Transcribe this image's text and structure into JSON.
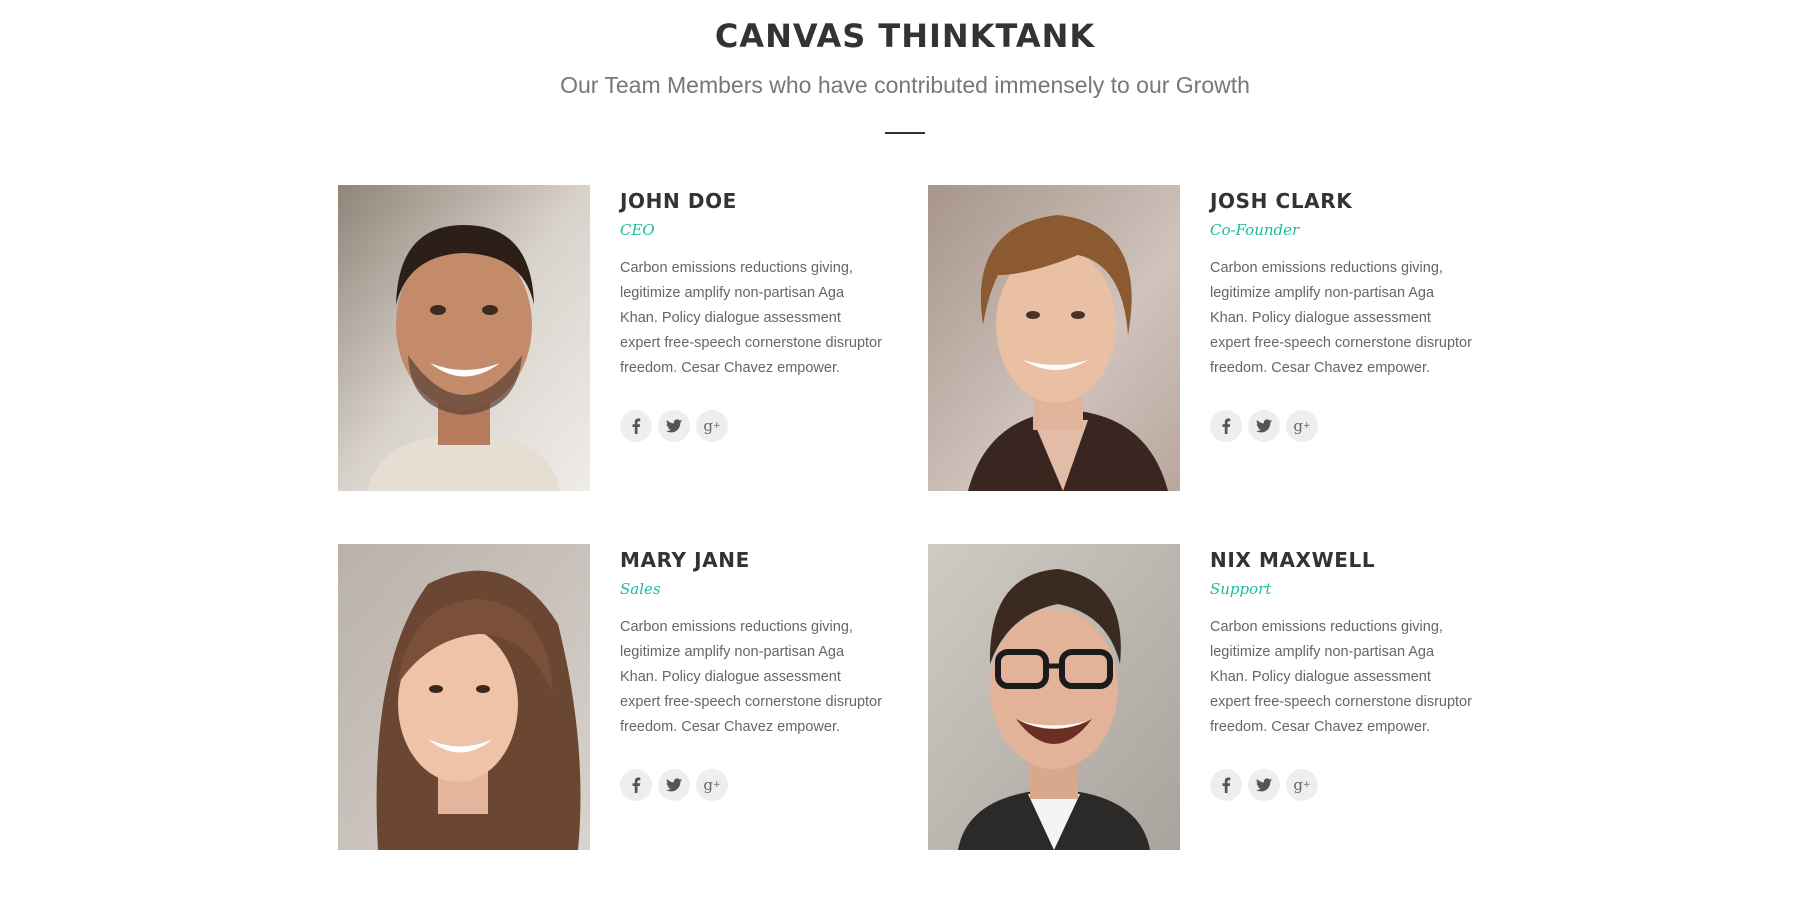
{
  "header": {
    "title": "CANVAS THINKTANK",
    "subtitle": "Our Team Members who have contributed immensely to our Growth"
  },
  "colors": {
    "accent": "#1abc9c",
    "heading": "#333333",
    "body_text": "#666666",
    "social_bg": "#eeeeee"
  },
  "team": [
    {
      "name": "JOHN DOE",
      "role": "CEO",
      "bio": "Carbon emissions reductions giving, legitimize amplify non-partisan Aga Khan. Policy dialogue assessment expert free-speech cornerstone disruptor freedom. Cesar Chavez empower.",
      "photo": "man-smiling-beard-photo",
      "socials": [
        "facebook-icon",
        "twitter-icon",
        "google-plus-icon"
      ]
    },
    {
      "name": "JOSH CLARK",
      "role": "Co-Founder",
      "bio": "Carbon emissions reductions giving, legitimize amplify non-partisan Aga Khan. Policy dialogue assessment expert free-speech cornerstone disruptor freedom. Cesar Chavez empower.",
      "photo": "young-man-wavy-hair-photo",
      "socials": [
        "facebook-icon",
        "twitter-icon",
        "google-plus-icon"
      ]
    },
    {
      "name": "MARY JANE",
      "role": "Sales",
      "bio": "Carbon emissions reductions giving, legitimize amplify non-partisan Aga Khan. Policy dialogue assessment expert free-speech cornerstone disruptor freedom. Cesar Chavez empower.",
      "photo": "woman-long-hair-photo",
      "socials": [
        "facebook-icon",
        "twitter-icon",
        "google-plus-icon"
      ]
    },
    {
      "name": "NIX MAXWELL",
      "role": "Support",
      "bio": "Carbon emissions reductions giving, legitimize amplify non-partisan Aga Khan. Policy dialogue assessment expert free-speech cornerstone disruptor freedom. Cesar Chavez empower.",
      "photo": "man-glasses-laughing-photo",
      "socials": [
        "facebook-icon",
        "twitter-icon",
        "google-plus-icon"
      ]
    }
  ]
}
